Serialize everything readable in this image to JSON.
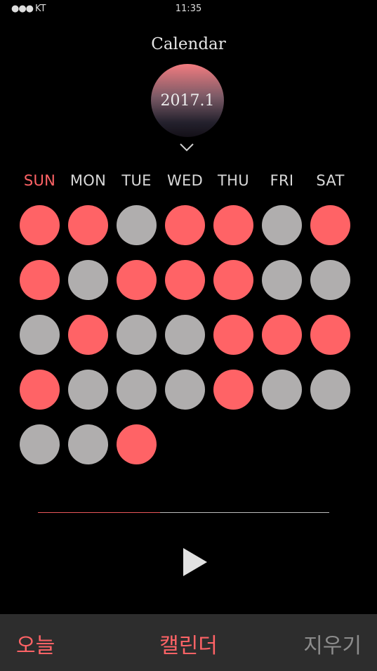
{
  "status_bar": {
    "carrier": "KT",
    "signal_dots": "●●●",
    "time": "11:35"
  },
  "header": {
    "title": "Calendar",
    "month": "2017.1"
  },
  "weekdays": [
    "SUN",
    "MON",
    "TUE",
    "WED",
    "THU",
    "FRI",
    "SAT"
  ],
  "colors": {
    "accent": "#ff6366",
    "inactive": "#b0aeae"
  },
  "days": [
    "red",
    "red",
    "gray",
    "red",
    "red",
    "gray",
    "red",
    "red",
    "gray",
    "red",
    "red",
    "red",
    "gray",
    "gray",
    "gray",
    "red",
    "gray",
    "gray",
    "red",
    "red",
    "red",
    "red",
    "gray",
    "gray",
    "gray",
    "red",
    "gray",
    "gray",
    "gray",
    "gray",
    "red"
  ],
  "progress": 0.42,
  "icons": {
    "expand": "chevron-down-icon",
    "play": "play-icon"
  },
  "tabs": {
    "today": "오늘",
    "calendar": "캘린더",
    "clear": "지우기"
  }
}
